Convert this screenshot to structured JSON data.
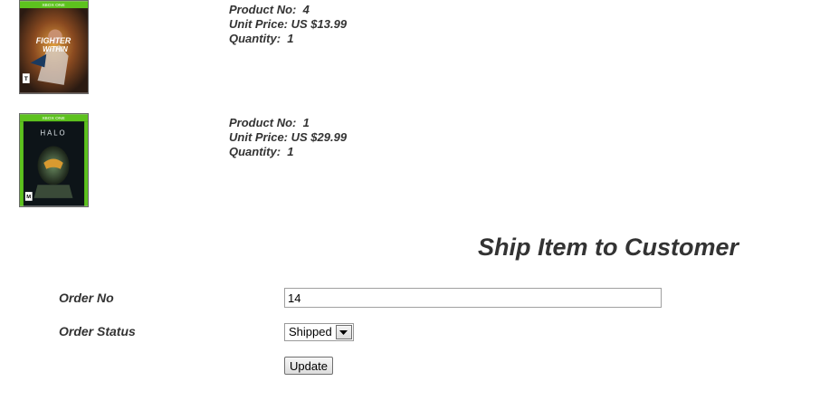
{
  "products": [
    {
      "cover_title": "Fighter Within",
      "cover_platform": "XBOX ONE",
      "no_label": "Product No:",
      "no_value": "4",
      "price_label": "Unit Price:",
      "price_value": "US $13.99",
      "qty_label": "Quantity:",
      "qty_value": "1"
    },
    {
      "cover_title": "Halo",
      "cover_platform": "XBOX ONE",
      "no_label": "Product No:",
      "no_value": "1",
      "price_label": "Unit Price:",
      "price_value": "US $29.99",
      "qty_label": "Quantity:",
      "qty_value": "1"
    }
  ],
  "ship_form": {
    "title": "Ship Item to Customer",
    "order_no_label": "Order No",
    "order_no_value": "14",
    "order_status_label": "Order Status",
    "order_status_value": "Shipped",
    "update_label": "Update"
  },
  "colors": {
    "text": "#333333",
    "xbox_green": "#5dc21e"
  },
  "icons": {
    "select_arrow": "chevron-down-icon"
  }
}
